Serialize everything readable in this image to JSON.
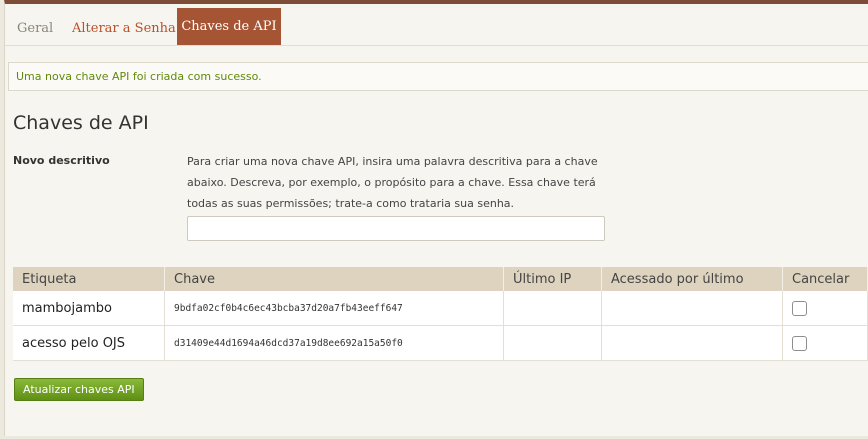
{
  "tabs": [
    {
      "label": "Geral"
    },
    {
      "label": "Alterar a Senha"
    },
    {
      "label": "Chaves de API"
    }
  ],
  "notice": "Uma nova chave API foi criada com sucesso.",
  "section_title": "Chaves de API",
  "new_descriptor": {
    "label": "Novo descritivo",
    "help": "Para criar uma nova chave API, insira uma palavra descritiva para a chave abaixo. Descreva, por exemplo, o propósito para a chave. Essa chave terá todas as suas permissões; trate-a como trataria sua senha.",
    "value": ""
  },
  "table": {
    "headers": [
      "Etiqueta",
      "Chave",
      "Último IP",
      "Acessado por último",
      "Cancelar"
    ],
    "rows": [
      {
        "label": "mambojambo",
        "key": "9bdfa02cf0b4c6ec43bcba37d20a7fb43eeff647",
        "last_ip": "",
        "last_access": "",
        "cancel": false
      },
      {
        "label": "acesso pelo OJS",
        "key": "d31409e44d1694a46dcd37a19d8ee692a15a50f0",
        "last_ip": "",
        "last_access": "",
        "cancel": false
      }
    ]
  },
  "update_button": "Atualizar chaves API",
  "colors": {
    "accent": "#a55534",
    "tab_link": "#b8512d",
    "success": "#5f8a0a",
    "button": "#6f9f22"
  }
}
